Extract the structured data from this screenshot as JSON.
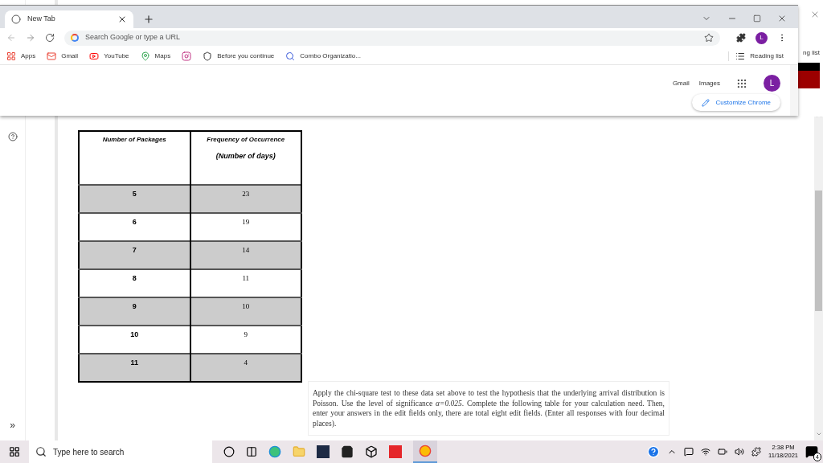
{
  "browser": {
    "tab": {
      "title": "New Tab"
    },
    "address_placeholder": "Search Google or type a URL",
    "profile_initial": "L",
    "bookmarks": [
      "Apps",
      "Gmail",
      "YouTube",
      "Maps",
      "Before you continue",
      "Combo Organizatio..."
    ],
    "reading_list": "Reading list",
    "new_tab_page": {
      "links": [
        "Gmail",
        "Images"
      ],
      "avatar": "L",
      "customize": "Customize Chrome"
    }
  },
  "behind_window": {
    "partial_label": "ng list"
  },
  "sidebar": {
    "expand": "»"
  },
  "table": {
    "columns": [
      {
        "lines": [
          "Number of Packages"
        ]
      },
      {
        "lines": [
          "Frequency of Occurrence",
          "(Number of days)"
        ]
      }
    ],
    "rows": [
      {
        "packages": "5",
        "days": "23",
        "shaded": true
      },
      {
        "packages": "6",
        "days": "19",
        "shaded": false
      },
      {
        "packages": "7",
        "days": "14",
        "shaded": true
      },
      {
        "packages": "8",
        "days": "11",
        "shaded": false
      },
      {
        "packages": "9",
        "days": "10",
        "shaded": true
      },
      {
        "packages": "10",
        "days": "9",
        "shaded": false
      },
      {
        "packages": "11",
        "days": "4",
        "shaded": true
      }
    ]
  },
  "question": "Apply the chi-square test to these data set above to test the hypothesis that the underlying arrival distribution is Poisson. Use the level of significance *α=0.025*. Complete the following table for your calculation need. Then, enter your answers in the edit fields only, there are total eight edit fields. (Enter all responses with four decimal places).",
  "taskbar": {
    "search_placeholder": "Type here to search",
    "time": "2:38 PM",
    "date": "11/18/2021",
    "notification_count": "4"
  }
}
